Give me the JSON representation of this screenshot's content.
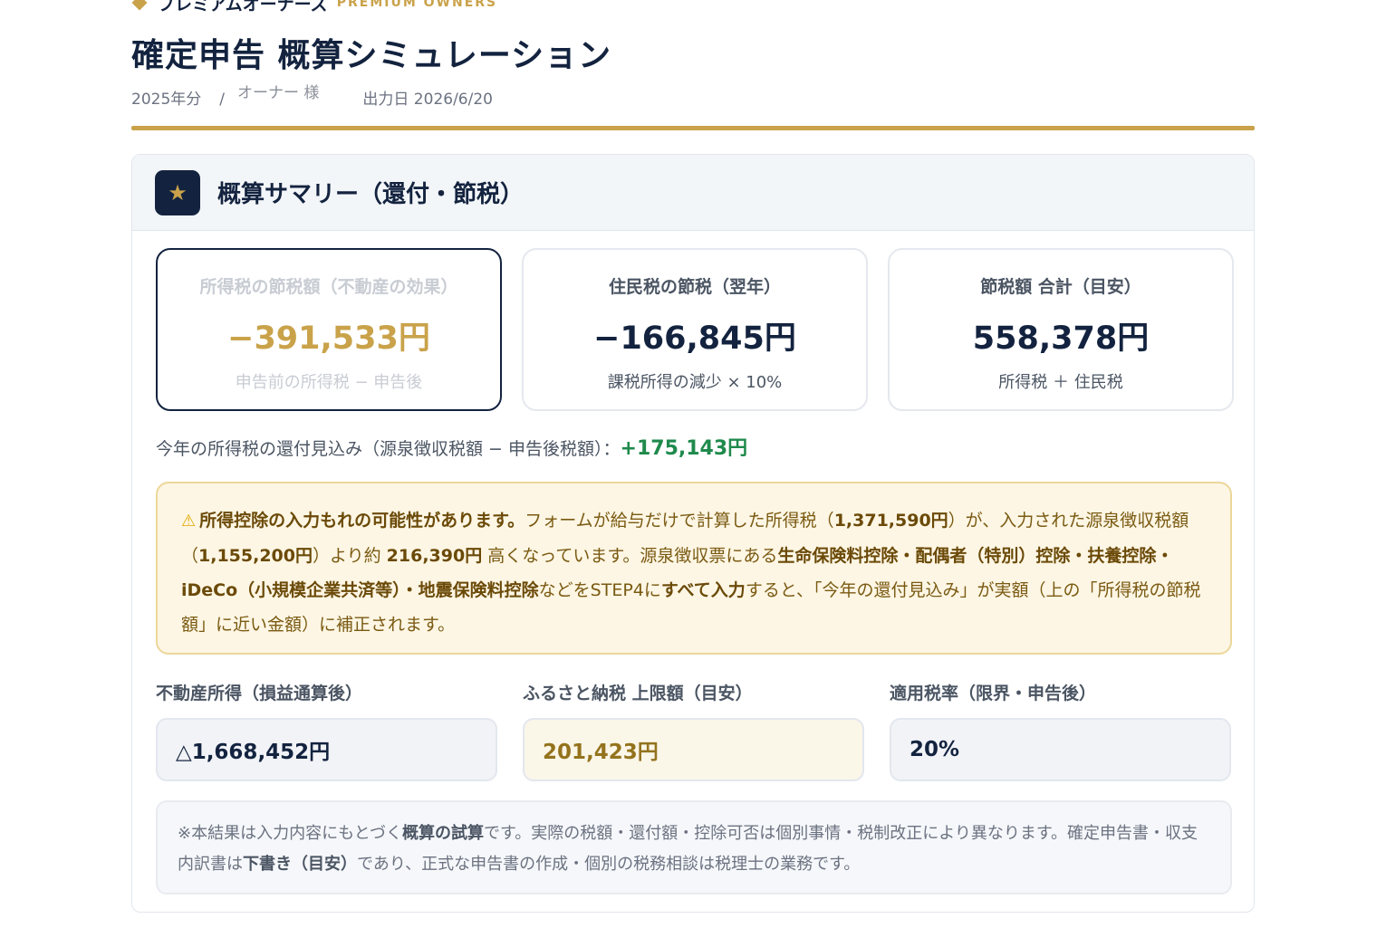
{
  "header": {
    "brand_jp": "プレミアムオーナーズ",
    "brand_en": "PREMIUM OWNERS",
    "title": "確定申告 概算シミュレーション",
    "year": "2025年分",
    "separator": "/",
    "owner": "オーナー 様",
    "output_date": "出力日 2026/6/20"
  },
  "summary": {
    "title": "概算サマリー（還付・節税）",
    "icon": "star-icon",
    "cards": [
      {
        "label": "所得税の節税額（不動産の効果）",
        "value": "−391,533円",
        "sub": "申告前の所得税 − 申告後"
      },
      {
        "label": "住民税の節税（翌年）",
        "value": "−166,845円",
        "sub": "課税所得の減少 × 10%"
      },
      {
        "label": "節税額 合計（目安）",
        "value": "558,378円",
        "sub": "所得税 ＋ 住民税"
      }
    ],
    "refund_label": "今年の所得税の還付見込み（源泉徴収税額 − 申告後税額）：",
    "refund_value": "+175,143円"
  },
  "warning": {
    "icon": "warning-icon",
    "t1": "所得控除の入力もれの可能性があります。",
    "t2": "フォームが給与だけで計算した所得税（",
    "t3": "1,371,590円",
    "t4": "）が、入力された源泉徴収税額（",
    "t5": "1,155,200円",
    "t6": "）より約",
    "t7": "216,390円",
    "t8": "高くなっています。源泉徴収票にある",
    "t9": "生命保険料控除・配偶者（特別）控除・扶養控除・iDeCo（小規模企業共済等）・地震保険料控除",
    "t10": "などをSTEP4に",
    "t11": "すべて入力",
    "t12": "すると、「今年の還付見込み」が実額（上の「所得税の節税額」に近い金額）に補正されます。"
  },
  "fields": [
    {
      "label": "不動産所得（損益通算後）",
      "value": "△1,668,452円"
    },
    {
      "label": "ふるさと納税 上限額（目安）",
      "value": "201,423円"
    },
    {
      "label": "適用税率（限界・申告後）",
      "value": "20%"
    }
  ],
  "note": {
    "n1": "※本結果は入力内容にもとづく",
    "n2": "概算の試算",
    "n3": "です。実際の税額・還付額・控除可否は個別事情・税制改正により異なります。確定申告書・収支内訳書は",
    "n4": "下書き（目安）",
    "n5": "であり、正式な申告書の作成・個別の税務相談は税理士の業務です。"
  },
  "colors": {
    "navy": "#13233f",
    "gold": "#c9a24a",
    "green": "#1f8a4c",
    "warn_bg": "#fdf6e4"
  }
}
